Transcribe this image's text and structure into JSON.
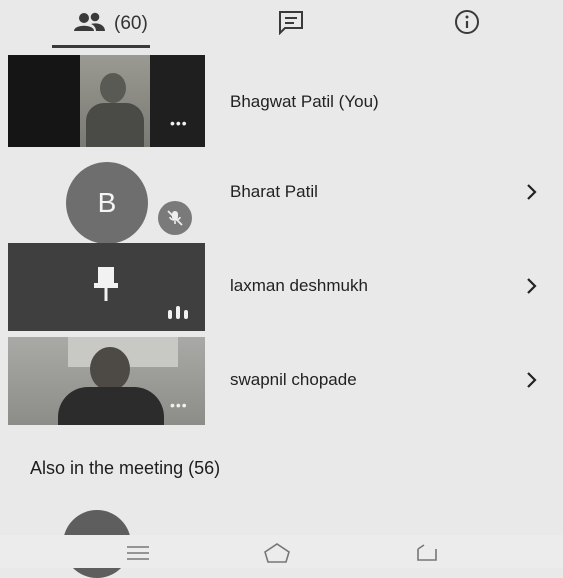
{
  "tabs": {
    "people_count": "(60)",
    "people_icon": "people-icon",
    "chat_icon": "chat-icon",
    "info_icon": "info-icon"
  },
  "participants": [
    {
      "name": "Bhagwat Patil (You)",
      "tile": "video",
      "more": "•••"
    },
    {
      "name": "Bharat Patil",
      "tile": "avatar",
      "initial": "B",
      "muted": true
    },
    {
      "name": "laxman deshmukh",
      "tile": "pinned",
      "pin_icon": "pin-icon",
      "audio_icon": "audio-level-icon"
    },
    {
      "name": "swapnil chopade",
      "tile": "video",
      "more": "•••"
    }
  ],
  "section": {
    "also_in_meeting": "Also in the meeting (56)"
  },
  "nav": {
    "menu_icon": "menu-icon",
    "home_icon": "home-icon",
    "back_icon": "back-icon"
  },
  "colors": {
    "background": "#e9e9e9",
    "tile_dark": "#3d3d3d",
    "avatar_gray": "#6e6e6e",
    "text": "#1d1d1d"
  }
}
